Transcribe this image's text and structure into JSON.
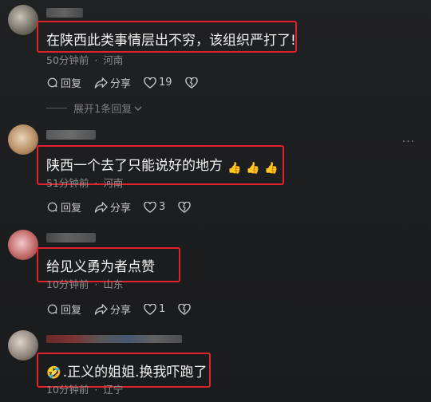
{
  "comments": [
    {
      "text": "在陕西此类事情层出不穷，该组织严打了!",
      "time": "50分钟前",
      "location": "河南",
      "reply_label": "回复",
      "share_label": "分享",
      "likes": "19",
      "expand_label": "展开1条回复"
    },
    {
      "text": "陕西一个去了只能说好的地方",
      "emoji": [
        "👍",
        "👍",
        "👍"
      ],
      "time": "51分钟前",
      "location": "河南",
      "reply_label": "回复",
      "share_label": "分享",
      "likes": "3",
      "more_label": "···"
    },
    {
      "text": "给见义勇为者点赞",
      "time": "10分钟前",
      "location": "山东",
      "reply_label": "回复",
      "share_label": "分享",
      "likes": "1"
    },
    {
      "text": ".正义的姐姐.换我吓跑了",
      "emoji_prefix": "🤣",
      "time": "10分钟前",
      "location": "辽宁"
    }
  ],
  "meta_separator": "·",
  "colors": {
    "highlight_box": "#e2232b",
    "meta_text": "#8d8d90"
  }
}
